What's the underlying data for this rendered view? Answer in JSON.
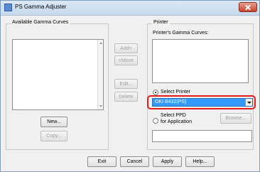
{
  "window": {
    "title": "PS Gamma Adjuster"
  },
  "left_group": {
    "label": "Available Gamma Curves",
    "new_button": "New...",
    "copy_button": "Copy..."
  },
  "middle_buttons": {
    "add": "Add>",
    "remove": "<Move",
    "edit": "Edit...",
    "delete": "Delete"
  },
  "printer_group": {
    "label": "Printer",
    "curves_label": "Printer's Gamma Curves:",
    "select_printer_label": "Select Printer",
    "selected_printer": "OKI B432(PS)",
    "select_ppd_line1": "Select PPD",
    "select_ppd_line2": "for Application",
    "browse_button": "Browse..."
  },
  "footer": {
    "exit": "Exit",
    "cancel": "Cancel",
    "apply": "Apply",
    "help": "Help..."
  }
}
